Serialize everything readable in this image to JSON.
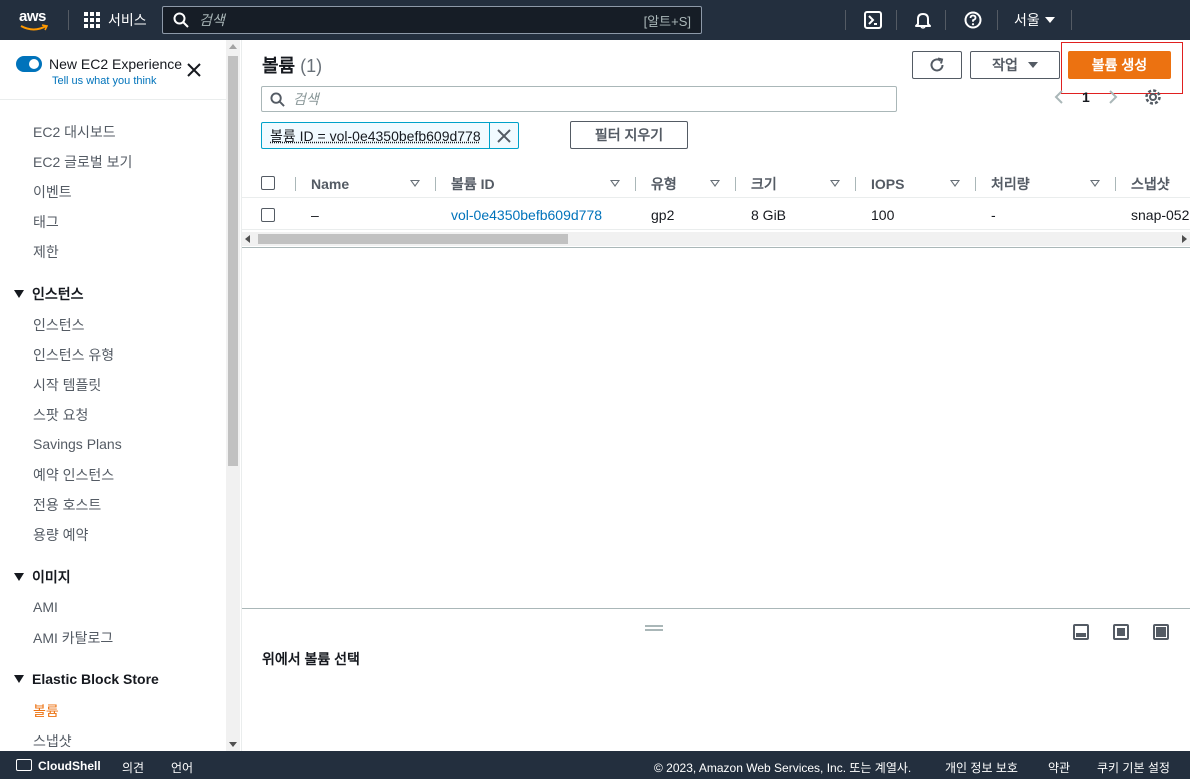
{
  "topnav": {
    "logo": "aws",
    "services_label": "서비스",
    "search_placeholder": "검색",
    "search_shortcut": "[알트+S]",
    "region_label": "서울"
  },
  "sidebar": {
    "experience_title": "New EC2 Experience",
    "experience_link": "Tell us what you think",
    "items": [
      {
        "label": "EC2 대시보드"
      },
      {
        "label": "EC2 글로벌 보기"
      },
      {
        "label": "이벤트"
      },
      {
        "label": "태그"
      },
      {
        "label": "제한"
      }
    ],
    "groups": [
      {
        "label": "인스턴스",
        "items": [
          "인스턴스",
          "인스턴스 유형",
          "시작 템플릿",
          "스팟 요청",
          "Savings Plans",
          "예약 인스턴스",
          "전용 호스트",
          "용량 예약"
        ]
      },
      {
        "label": "이미지",
        "items": [
          "AMI",
          "AMI 카탈로그"
        ]
      },
      {
        "label": "Elastic Block Store",
        "items": [
          "볼륨",
          "스냅샷"
        ]
      }
    ],
    "active_item": "볼륨"
  },
  "main": {
    "title": "볼륨",
    "count": "(1)",
    "actions_label": "작업",
    "create_label": "볼륨 생성",
    "search_placeholder": "검색",
    "page_number": "1",
    "filter_token": "볼륨 ID = vol-0e4350befb609d778",
    "clear_filters_label": "필터 지우기",
    "columns": [
      "Name",
      "볼륨 ID",
      "유형",
      "크기",
      "IOPS",
      "처리량",
      "스냅샷"
    ],
    "rows": [
      {
        "name": "–",
        "volume_id": "vol-0e4350befb609d778",
        "type": "gp2",
        "size": "8 GiB",
        "iops": "100",
        "throughput": "-",
        "snapshot": "snap-052"
      }
    ],
    "split_panel_text": "위에서 볼륨 선택"
  },
  "footer": {
    "cloudshell": "CloudShell",
    "feedback": "의견",
    "language": "언어",
    "copyright": "© 2023, Amazon Web Services, Inc. 또는 계열사.",
    "privacy": "개인 정보 보호",
    "terms": "약관",
    "cookies": "쿠키 기본 설정"
  },
  "colors": {
    "nav_bg": "#232f3e",
    "primary": "#ec7211",
    "link": "#0073bb",
    "highlight": "#e02020"
  },
  "icons": [
    "aws-logo",
    "grid-icon",
    "search-icon",
    "cloudshell-icon",
    "bell-icon",
    "help-icon",
    "close-icon",
    "refresh-icon",
    "caret-down-icon",
    "chevron-left-icon",
    "chevron-right-icon",
    "settings-icon"
  ]
}
